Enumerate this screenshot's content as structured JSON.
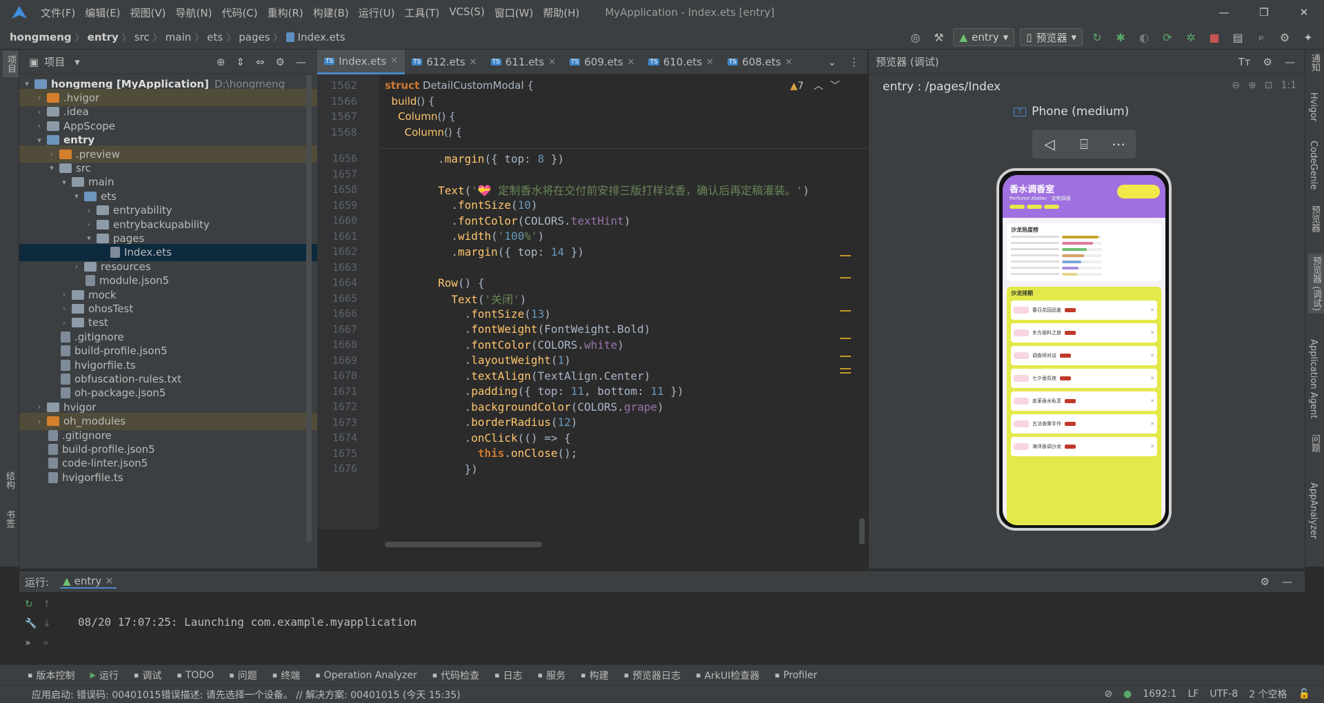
{
  "menu": {
    "items": [
      "文件(F)",
      "编辑(E)",
      "视图(V)",
      "导航(N)",
      "代码(C)",
      "重构(R)",
      "构建(B)",
      "运行(U)",
      "工具(T)",
      "VCS(S)",
      "窗口(W)",
      "帮助(H)"
    ],
    "window_title": "MyApplication - Index.ets [entry]"
  },
  "breadcrumb": [
    "hongmeng",
    "entry",
    "src",
    "main",
    "ets",
    "pages",
    "Index.ets"
  ],
  "toolbar": {
    "module": "entry",
    "device": "预览器"
  },
  "project": {
    "title": "项目",
    "tree": [
      {
        "label": "hongmeng [MyApplication]",
        "extra": "D:\\hongmeng",
        "depth": 0,
        "type": "folder",
        "color": "blue",
        "open": true
      },
      {
        "label": ".hvigor",
        "depth": 1,
        "type": "folder",
        "color": "orange",
        "open": false,
        "hl": true
      },
      {
        "label": ".idea",
        "depth": 1,
        "type": "folder",
        "color": "gray",
        "open": false
      },
      {
        "label": "AppScope",
        "depth": 1,
        "type": "folder",
        "color": "gray",
        "open": false
      },
      {
        "label": "entry",
        "depth": 1,
        "type": "folder",
        "color": "blue",
        "open": true,
        "bold": true
      },
      {
        "label": ".preview",
        "depth": 2,
        "type": "folder",
        "color": "orange",
        "open": false,
        "hl": true
      },
      {
        "label": "src",
        "depth": 2,
        "type": "folder",
        "color": "gray",
        "open": true
      },
      {
        "label": "main",
        "depth": 3,
        "type": "folder",
        "color": "gray",
        "open": true
      },
      {
        "label": "ets",
        "depth": 4,
        "type": "folder",
        "color": "blue",
        "open": true
      },
      {
        "label": "entryability",
        "depth": 5,
        "type": "folder",
        "color": "gray",
        "open": false
      },
      {
        "label": "entrybackupability",
        "depth": 5,
        "type": "folder",
        "color": "gray",
        "open": false
      },
      {
        "label": "pages",
        "depth": 5,
        "type": "folder",
        "color": "gray",
        "open": true
      },
      {
        "label": "Index.ets",
        "depth": 6,
        "type": "file",
        "sel": true
      },
      {
        "label": "resources",
        "depth": 4,
        "type": "folder",
        "color": "gray",
        "open": false
      },
      {
        "label": "module.json5",
        "depth": 4,
        "type": "file"
      },
      {
        "label": "mock",
        "depth": 3,
        "type": "folder",
        "color": "gray",
        "open": false
      },
      {
        "label": "ohosTest",
        "depth": 3,
        "type": "folder",
        "color": "gray",
        "open": false
      },
      {
        "label": "test",
        "depth": 3,
        "type": "folder",
        "color": "gray",
        "open": false
      },
      {
        "label": ".gitignore",
        "depth": 2,
        "type": "file"
      },
      {
        "label": "build-profile.json5",
        "depth": 2,
        "type": "file"
      },
      {
        "label": "hvigorfile.ts",
        "depth": 2,
        "type": "file"
      },
      {
        "label": "obfuscation-rules.txt",
        "depth": 2,
        "type": "file"
      },
      {
        "label": "oh-package.json5",
        "depth": 2,
        "type": "file"
      },
      {
        "label": "hvigor",
        "depth": 1,
        "type": "folder",
        "color": "gray",
        "open": false
      },
      {
        "label": "oh_modules",
        "depth": 1,
        "type": "folder",
        "color": "orange",
        "open": false,
        "hl": true
      },
      {
        "label": ".gitignore",
        "depth": 1,
        "type": "file"
      },
      {
        "label": "build-profile.json5",
        "depth": 1,
        "type": "file"
      },
      {
        "label": "code-linter.json5",
        "depth": 1,
        "type": "file"
      },
      {
        "label": "hvigorfile.ts",
        "depth": 1,
        "type": "file"
      }
    ]
  },
  "tabs": [
    "Index.ets",
    "612.ets",
    "611.ets",
    "609.ets",
    "610.ets",
    "608.ets"
  ],
  "editor": {
    "warnings": "7",
    "sticky": [
      {
        "n": "1562",
        "t": "struct DetailCustomModal {"
      },
      {
        "n": "1566",
        "t": "  build() {"
      },
      {
        "n": "1567",
        "t": "    Column() {"
      },
      {
        "n": "1568",
        "t": "      Column() {"
      }
    ],
    "lines": [
      {
        "n": "1656",
        "t": "        .margin({ top: 8 })"
      },
      {
        "n": "1657",
        "t": ""
      },
      {
        "n": "1658",
        "t": "        Text('💝 定制香水将在交付前安排三版打样试香，确认后再定稿灌装。')"
      },
      {
        "n": "1659",
        "t": "          .fontSize(10)"
      },
      {
        "n": "1660",
        "t": "          .fontColor(COLORS.textHint)"
      },
      {
        "n": "1661",
        "t": "          .width('100%')"
      },
      {
        "n": "1662",
        "t": "          .margin({ top: 14 })"
      },
      {
        "n": "1663",
        "t": ""
      },
      {
        "n": "1664",
        "t": "        Row() {"
      },
      {
        "n": "1665",
        "t": "          Text('关闭')"
      },
      {
        "n": "1666",
        "t": "            .fontSize(13)"
      },
      {
        "n": "1667",
        "t": "            .fontWeight(FontWeight.Bold)"
      },
      {
        "n": "1668",
        "t": "            .fontColor(COLORS.white)"
      },
      {
        "n": "1669",
        "t": "            .layoutWeight(1)"
      },
      {
        "n": "1670",
        "t": "            .textAlign(TextAlign.Center)"
      },
      {
        "n": "1671",
        "t": "            .padding({ top: 11, bottom: 11 })"
      },
      {
        "n": "1672",
        "t": "            .backgroundColor(COLORS.grape)"
      },
      {
        "n": "1673",
        "t": "            .borderRadius(12)"
      },
      {
        "n": "1674",
        "t": "            .onClick(() => {"
      },
      {
        "n": "1675",
        "t": "              this.onClose();"
      },
      {
        "n": "1676",
        "t": "            })"
      }
    ]
  },
  "preview": {
    "title": "预览器 (调试)",
    "path": "entry : /pages/Index",
    "device": "Phone (medium)",
    "app": {
      "title": "香水调香室",
      "subtitle": "Perfume Atelier · 定制调香",
      "section1": "沙龙热度榜",
      "section2": "沙龙排期",
      "bars": [
        {
          "v": 0.92,
          "c": "#c9a227"
        },
        {
          "v": 0.78,
          "c": "#e07a9a"
        },
        {
          "v": 0.62,
          "c": "#6cc070"
        },
        {
          "v": 0.55,
          "c": "#d9a06a"
        },
        {
          "v": 0.48,
          "c": "#7aa6d8"
        },
        {
          "v": 0.42,
          "c": "#a38be0"
        },
        {
          "v": 0.38,
          "c": "#e8d48a"
        }
      ],
      "events": [
        "春日花园品鉴",
        "东方香料之旅",
        "调香师对谈",
        "七夕香氛夜",
        "皮革香水私享",
        "古法香膏手作",
        "海洋香调沙龙"
      ]
    }
  },
  "run": {
    "label": "运行:",
    "config": "entry",
    "log": "08/20 17:07:25: Launching com.example.myapplication"
  },
  "bottom_tabs": [
    "版本控制",
    "运行",
    "调试",
    "TODO",
    "问题",
    "终端",
    "Operation Analyzer",
    "代码检查",
    "日志",
    "服务",
    "构建",
    "预览器日志",
    "ArkUI检查器",
    "Profiler"
  ],
  "status": {
    "message": "应用启动: 错误码: 00401015错误描述: 请先选择一个设备。 // 解决方案: 00401015 (今天 15:35)",
    "position": "1692:1",
    "line_sep": "LF",
    "encoding": "UTF-8",
    "indent": "2 个空格"
  },
  "left_strip": [
    "项目",
    "结构",
    "书签"
  ],
  "right_strip": [
    "通知",
    "Hvigor",
    "CodeGenie",
    "预览器",
    "预览器 (调试)",
    "Application Agent",
    "问题",
    "AppAnalyzer"
  ]
}
